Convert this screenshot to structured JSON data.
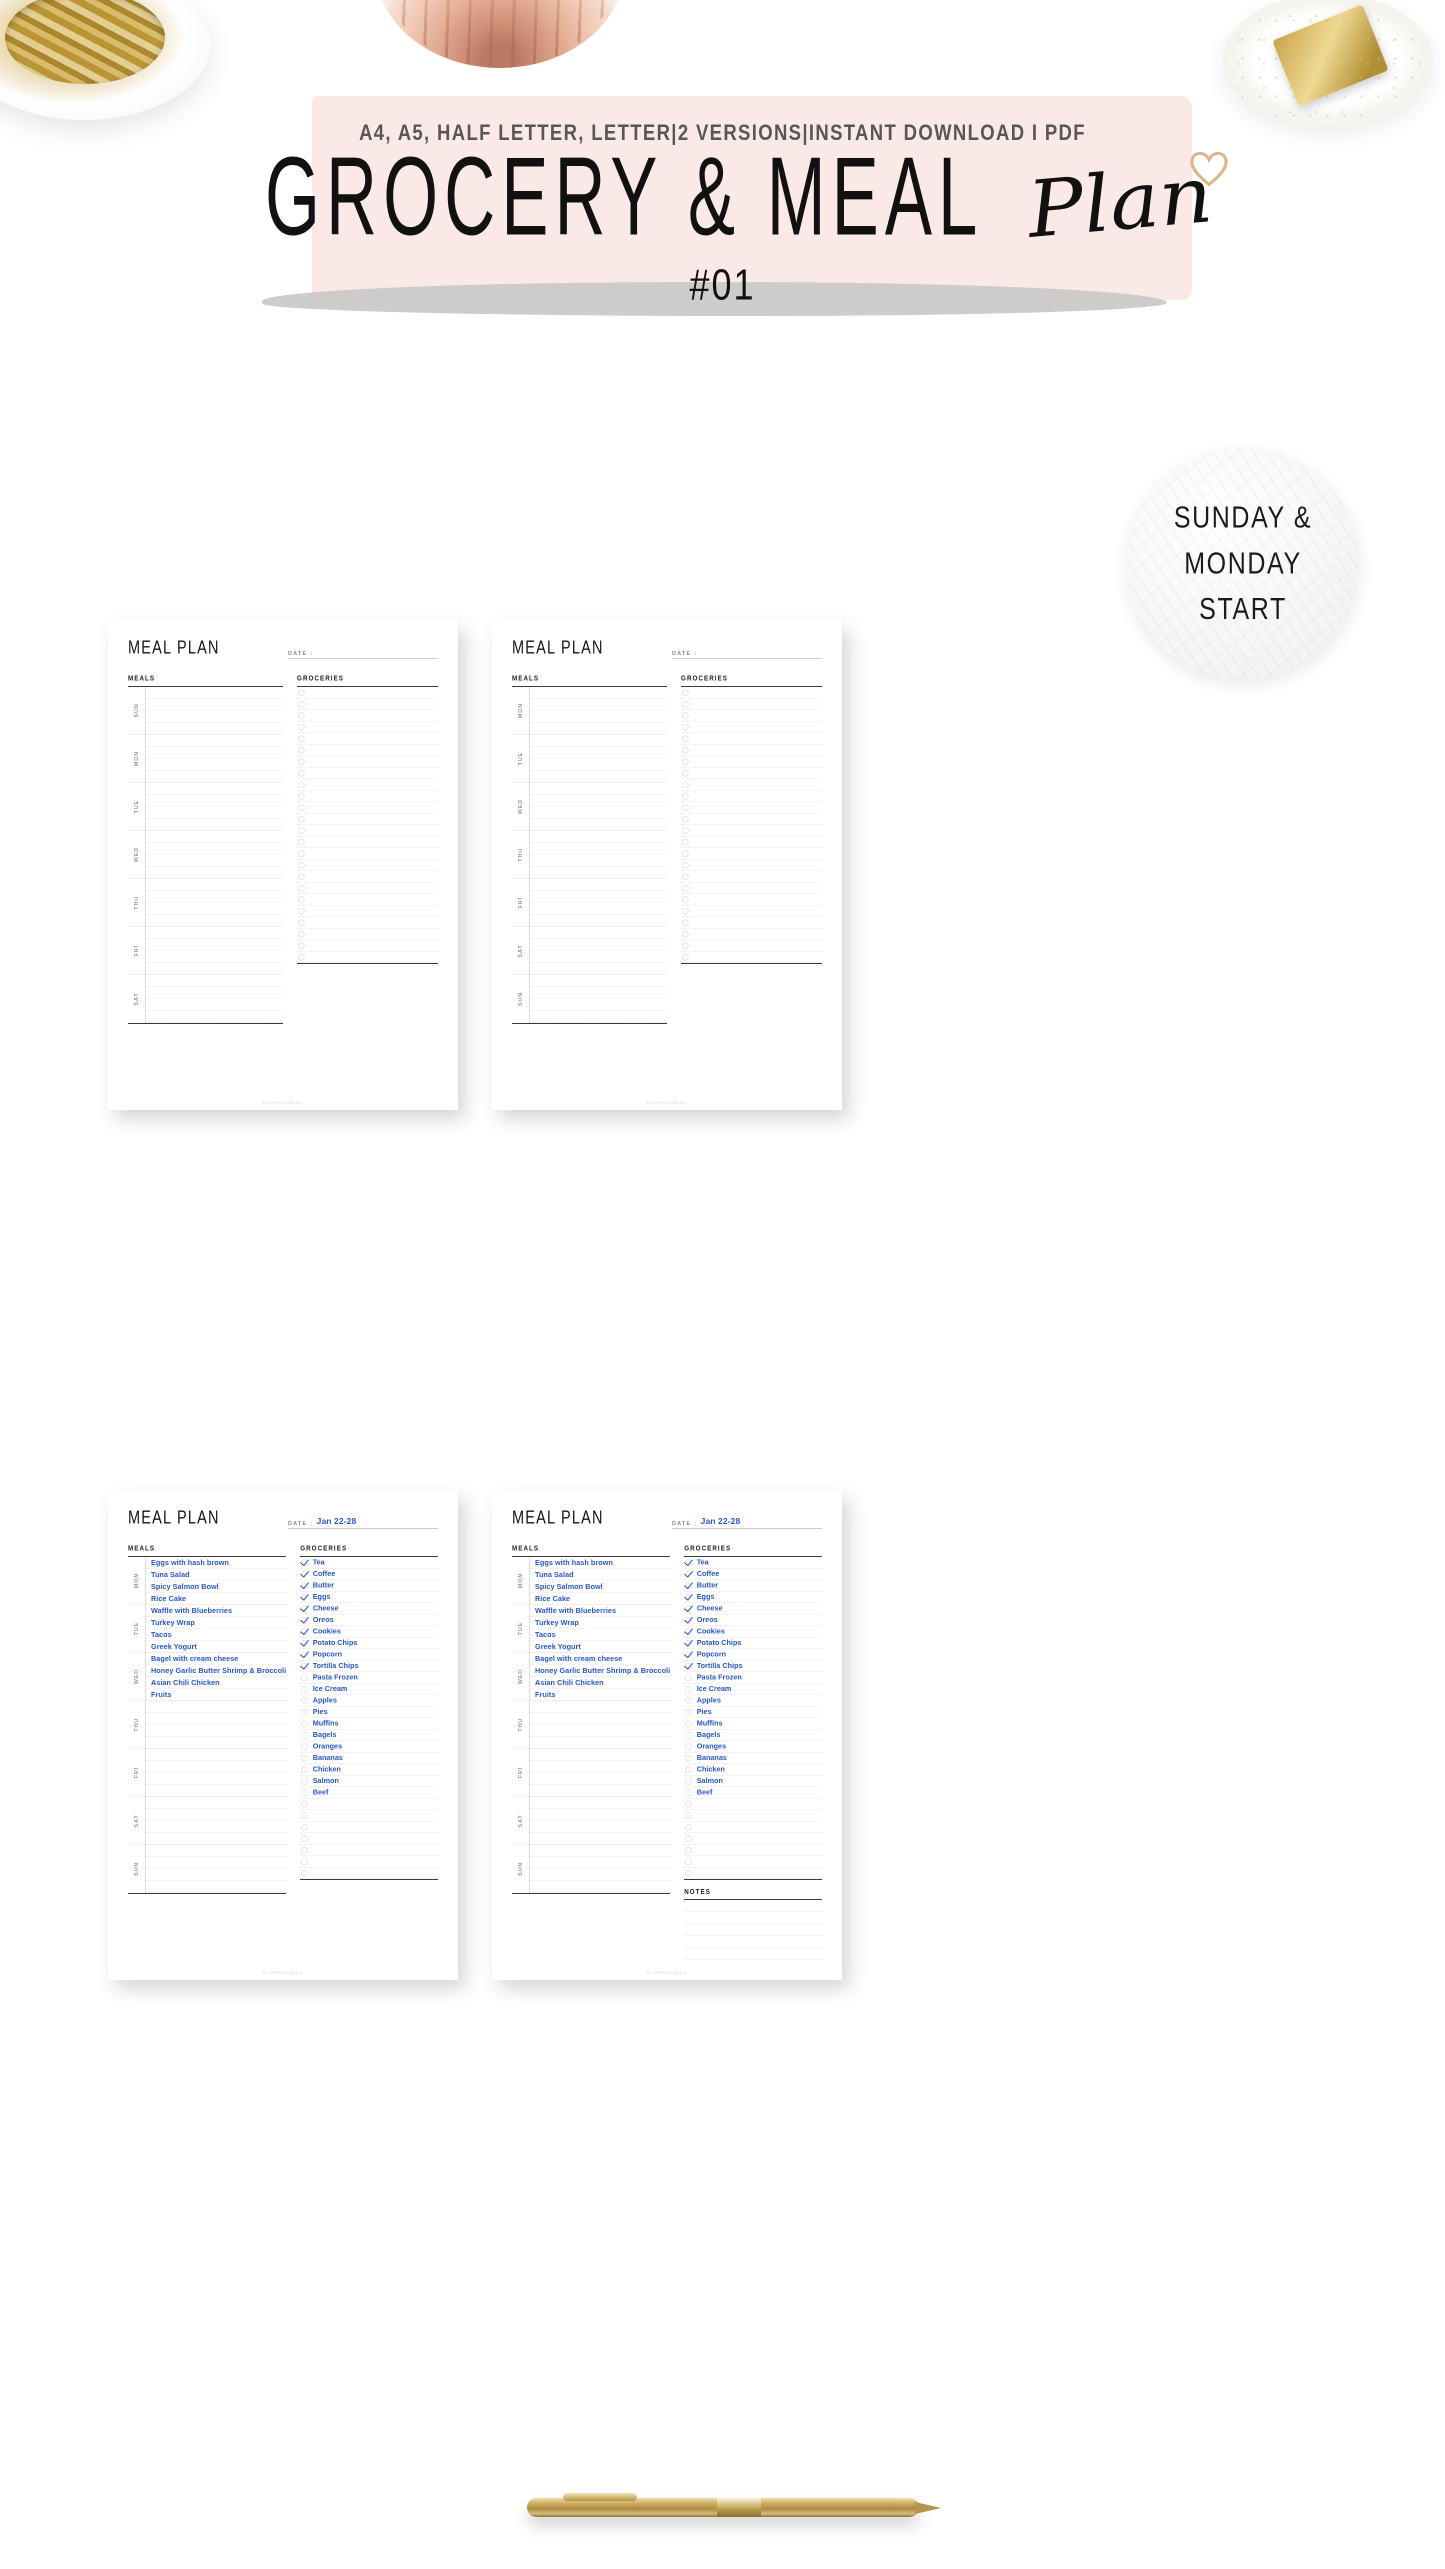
{
  "listing": {
    "kicker": "A4, A5, HALF LETTER, LETTER|2 VERSIONS|INSTANT DOWNLOAD I PDF",
    "title_main": "GROCERY & MEAL",
    "title_script": "Plan",
    "issue": "#01",
    "badge_line1": "SUNDAY &",
    "badge_line2": "MONDAY",
    "badge_line3": "START",
    "colors": {
      "pink_swash": "#fae9e6",
      "grey_swash": "#c9c9c9",
      "ink_blue": "#2a56c6",
      "heart": "#e0b48a",
      "text_dark": "#111111",
      "kicker_grey": "#575757"
    }
  },
  "planner": {
    "title": "MEAL PLAN",
    "date_label": "DATE :",
    "date_value": "Jan 22-28",
    "date_value_blank": "",
    "meals_label": "MEALS",
    "groceries_label": "GROCERIES",
    "notes_label": "NOTES",
    "watermark": "BY PRINTABLEY",
    "days_sunday_start": [
      "SUN",
      "MON",
      "TUE",
      "WED",
      "THU",
      "FRI",
      "SAT"
    ],
    "days_monday_start": [
      "MON",
      "TUE",
      "WED",
      "THU",
      "FRI",
      "SAT",
      "SUN"
    ],
    "rows_per_day": 4,
    "grocery_rows_blank": 24,
    "grocery_rows_filled": 28,
    "note_rows": 5
  },
  "filled": {
    "meals": [
      "Eggs with hash brown",
      "Tuna Salad",
      "Spicy Salmon Bowl",
      "Rice Cake",
      "Waffle with Blueberries",
      "Turkey Wrap",
      "Tacos",
      "Greek Yogurt",
      "Bagel with cream cheese",
      "Honey Garlic Butter Shrimp & Broccoli",
      "Asian Chili Chicken",
      "Fruits"
    ],
    "groceries": [
      {
        "name": "Tea",
        "checked": true
      },
      {
        "name": "Coffee",
        "checked": true
      },
      {
        "name": "Butter",
        "checked": true
      },
      {
        "name": "Eggs",
        "checked": true
      },
      {
        "name": "Cheese",
        "checked": true
      },
      {
        "name": "Oreos",
        "checked": true
      },
      {
        "name": "Cookies",
        "checked": true
      },
      {
        "name": "Potato Chips",
        "checked": true
      },
      {
        "name": "Popcorn",
        "checked": true
      },
      {
        "name": "Tortilla Chips",
        "checked": true
      },
      {
        "name": "Pasta Frozen",
        "checked": false
      },
      {
        "name": "Ice Cream",
        "checked": false
      },
      {
        "name": "Apples",
        "checked": false
      },
      {
        "name": "Pies",
        "checked": false
      },
      {
        "name": "Muffins",
        "checked": false
      },
      {
        "name": "Bagels",
        "checked": false
      },
      {
        "name": "Oranges",
        "checked": false
      },
      {
        "name": "Bananas",
        "checked": false
      },
      {
        "name": "Chicken",
        "checked": false
      },
      {
        "name": "Salmon",
        "checked": false
      },
      {
        "name": "Beef",
        "checked": false
      }
    ]
  },
  "pages": [
    {
      "id": "blank-sunday",
      "start": "sunday",
      "filled": false,
      "notes": false
    },
    {
      "id": "blank-monday",
      "start": "monday",
      "filled": false,
      "notes": false
    },
    {
      "id": "filled-sunday",
      "start": "monday",
      "filled": true,
      "notes": false
    },
    {
      "id": "filled-monday",
      "start": "monday",
      "filled": true,
      "notes": true
    }
  ]
}
